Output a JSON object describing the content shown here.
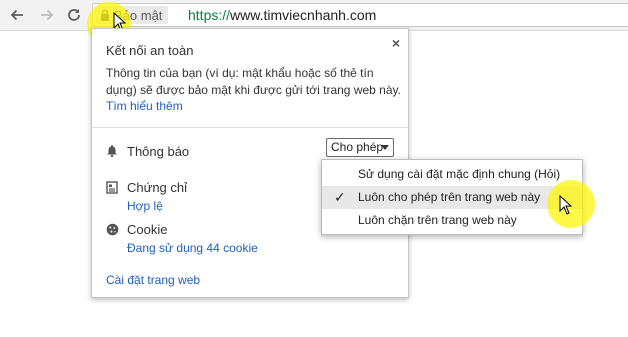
{
  "toolbar": {
    "security_chip_label": "Bảo mật",
    "url_scheme": "https://",
    "url_host": "www.timviecnhanh.com"
  },
  "popup": {
    "title": "Kết nối an toàn",
    "description": "Thông tin của bạn (ví dụ: mật khẩu hoặc số thẻ tín dụng) sẽ được bảo mật khi được gửi tới trang web này.",
    "learn_more": "Tìm hiểu thêm",
    "close_glyph": "×",
    "notifications": {
      "label": "Thông báo",
      "selected_value": "Cho phép"
    },
    "certificate": {
      "label": "Chứng chỉ",
      "status": "Hợp lệ"
    },
    "cookie": {
      "label": "Cookie",
      "status": "Đang sử dụng 44 cookie"
    },
    "site_settings": "Cài đặt trang web"
  },
  "dropdown": {
    "options": [
      {
        "label": "Sử dụng cài đặt mặc định chung (Hỏi)",
        "checked": false
      },
      {
        "label": "Luôn cho phép trên trang web này",
        "checked": true
      },
      {
        "label": "Luôn chặn trên trang web này",
        "checked": false
      }
    ],
    "check_glyph": "✓"
  },
  "colors": {
    "highlight": "#fff500",
    "link": "#1f5fbf",
    "secure_green": "#0b8043"
  },
  "icons": {
    "back": "back-arrow-icon",
    "forward": "forward-arrow-icon",
    "reload": "reload-icon",
    "lock": "lock-icon",
    "bell": "bell-icon",
    "certificate": "certificate-icon",
    "cookie": "cookie-icon"
  }
}
